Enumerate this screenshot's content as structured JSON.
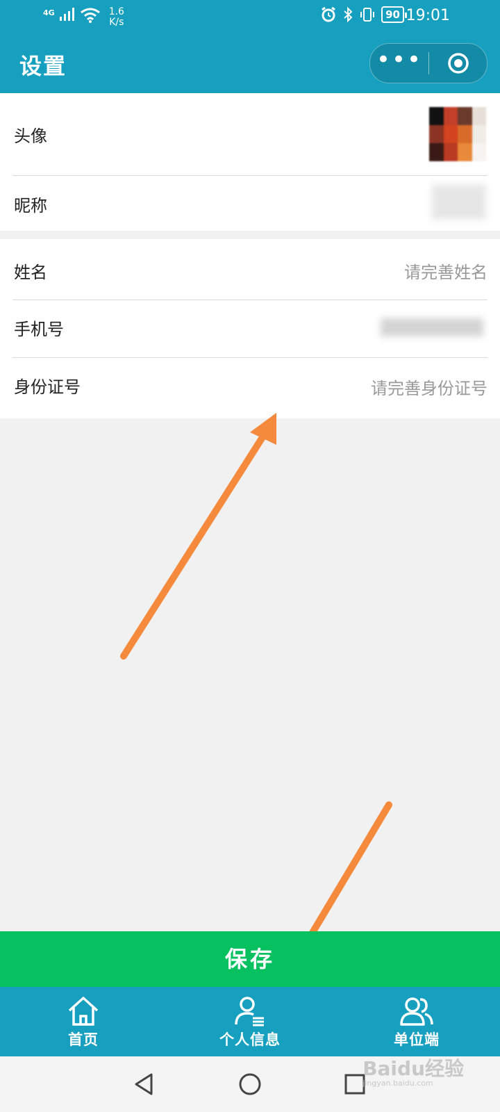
{
  "status_bar": {
    "network": "4G",
    "speed_value": "1.6",
    "speed_unit": "K/s",
    "battery": "90",
    "time": "19:01"
  },
  "header": {
    "title": "设置",
    "more_icon": "more-icon",
    "close_icon": "target-icon"
  },
  "profile": {
    "avatar_label": "头像",
    "nickname_label": "昵称"
  },
  "info": {
    "name_label": "姓名",
    "name_placeholder": "请完善姓名",
    "phone_label": "手机号",
    "id_label": "身份证号",
    "id_placeholder": "请完善身份证号"
  },
  "save_label": "保存",
  "tabs": [
    {
      "label": "首页",
      "icon": "home-icon"
    },
    {
      "label": "个人信息",
      "icon": "user-info-icon"
    },
    {
      "label": "单位端",
      "icon": "group-icon"
    }
  ],
  "watermark": {
    "brand": "Baidu经验",
    "url": "jingyan.baidu.com"
  },
  "colors": {
    "header": "#169fbe",
    "save": "#07c160",
    "arrow": "#f58a3c"
  }
}
